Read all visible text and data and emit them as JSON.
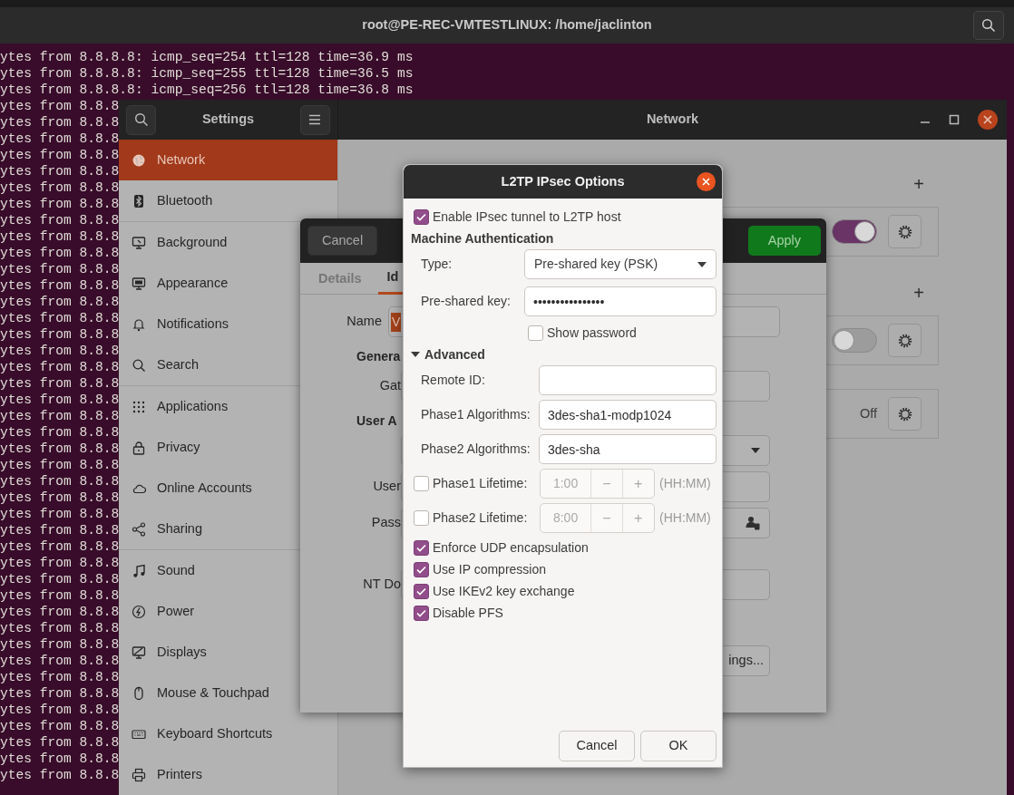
{
  "terminal": {
    "title": "root@PE-REC-VMTESTLINUX: /home/jaclinton",
    "lines": [
      "ytes from 8.8.8.8: icmp_seq=254 ttl=128 time=36.9 ms",
      "ytes from 8.8.8.8: icmp_seq=255 ttl=128 time=36.5 ms",
      "ytes from 8.8.8.8: icmp_seq=256 ttl=128 time=36.8 ms",
      "ytes from 8.8.8",
      "ytes from 8.8.8",
      "ytes from 8.8.8",
      "ytes from 8.8.8",
      "ytes from 8.8.8",
      "ytes from 8.8.8",
      "ytes from 8.8.8",
      "ytes from 8.8.8",
      "ytes from 8.8.8",
      "ytes from 8.8.8",
      "ytes from 8.8.8",
      "ytes from 8.8.8",
      "ytes from 8.8.8",
      "ytes from 8.8.8",
      "ytes from 8.8.8",
      "ytes from 8.8.8",
      "ytes from 8.8.8",
      "ytes from 8.8.8",
      "ytes from 8.8.8",
      "ytes from 8.8.8",
      "ytes from 8.8.8",
      "ytes from 8.8.8",
      "ytes from 8.8.8",
      "ytes from 8.8.8",
      "ytes from 8.8.8",
      "ytes from 8.8.8",
      "ytes from 8.8.8",
      "ytes from 8.8.8",
      "ytes from 8.8.8",
      "ytes from 8.8.8",
      "ytes from 8.8.8",
      "ytes from 8.8.8",
      "ytes from 8.8.8",
      "ytes from 8.8.8",
      "ytes from 8.8.8",
      "ytes from 8.8.8",
      "ytes from 8.8.8",
      "ytes from 8.8.8",
      "ytes from 8.8.8",
      "ytes from 8.8.8",
      "ytes from 8.8.8",
      "ytes from 8.8.8"
    ]
  },
  "settings": {
    "title": "Settings",
    "page_title": "Network",
    "sidebar_groups": [
      [
        {
          "label": "Network",
          "selected": true
        },
        {
          "label": "Bluetooth",
          "selected": false
        }
      ],
      [
        {
          "label": "Background",
          "selected": false
        },
        {
          "label": "Appearance",
          "selected": false
        },
        {
          "label": "Notifications",
          "selected": false
        },
        {
          "label": "Search",
          "selected": false
        }
      ],
      [
        {
          "label": "Applications",
          "selected": false
        },
        {
          "label": "Privacy",
          "selected": false
        },
        {
          "label": "Online Accounts",
          "selected": false
        },
        {
          "label": "Sharing",
          "selected": false
        }
      ],
      [
        {
          "label": "Sound",
          "selected": false
        },
        {
          "label": "Power",
          "selected": false
        },
        {
          "label": "Displays",
          "selected": false
        },
        {
          "label": "Mouse & Touchpad",
          "selected": false
        },
        {
          "label": "Keyboard Shortcuts",
          "selected": false
        },
        {
          "label": "Printers",
          "selected": false
        }
      ]
    ],
    "sections": [
      {
        "add": "+",
        "row": {
          "kind": "switch",
          "on": true
        }
      },
      {
        "add": "+",
        "row": {
          "kind": "switch",
          "on": false
        }
      },
      {
        "row": {
          "kind": "status",
          "status": "Off"
        }
      }
    ]
  },
  "vpn_dialog": {
    "cancel": "Cancel",
    "apply": "Apply",
    "tabs": [
      {
        "label": "Details",
        "selected": false
      },
      {
        "label": "Id",
        "selected": true
      }
    ],
    "rows": [
      {
        "kind": "name",
        "label": "Name",
        "value": "V"
      },
      {
        "kind": "heading",
        "label": "Genera"
      },
      {
        "kind": "field",
        "label": "Gat"
      },
      {
        "kind": "heading",
        "label": "User A"
      },
      {
        "kind": "dropdown"
      },
      {
        "kind": "field",
        "label": "User"
      },
      {
        "kind": "password",
        "label": "Pass"
      },
      {
        "kind": "field",
        "label": "NT Do"
      },
      {
        "kind": "button",
        "label": "ings..."
      }
    ]
  },
  "l2tp": {
    "title": "L2TP IPsec Options",
    "enable": {
      "label": "Enable IPsec tunnel to L2TP host",
      "checked": true
    },
    "heading": "Machine Authentication",
    "type": {
      "label": "Type:",
      "value": "Pre-shared key (PSK)"
    },
    "psk": {
      "label": "Pre-shared key:",
      "value": "••••••••••••••••"
    },
    "show_password": {
      "label": "Show password",
      "checked": false
    },
    "advanced": {
      "label": "Advanced",
      "expanded": true,
      "fields": [
        {
          "label": "Remote ID:"
        },
        {
          "label": "Phase1 Algorithms:",
          "value": "3des-sha1-modp1024"
        },
        {
          "label": "Phase2 Algorithms:",
          "value": "3des-sha"
        }
      ]
    },
    "lifetimes": [
      {
        "label": "Phase1 Lifetime:",
        "checked": false,
        "value": "1:00",
        "minus": "−",
        "plus": "+",
        "unit": "(HH:MM)"
      },
      {
        "label": "Phase2 Lifetime:",
        "checked": false,
        "value": "8:00",
        "minus": "−",
        "plus": "+",
        "unit": "(HH:MM)"
      }
    ],
    "options": [
      {
        "label": "Enforce UDP encapsulation",
        "checked": true
      },
      {
        "label": "Use IP compression",
        "checked": true
      },
      {
        "label": "Use IKEv2 key exchange",
        "checked": true
      },
      {
        "label": "Disable PFS",
        "checked": true
      }
    ],
    "buttons": [
      "Cancel",
      "OK"
    ]
  }
}
